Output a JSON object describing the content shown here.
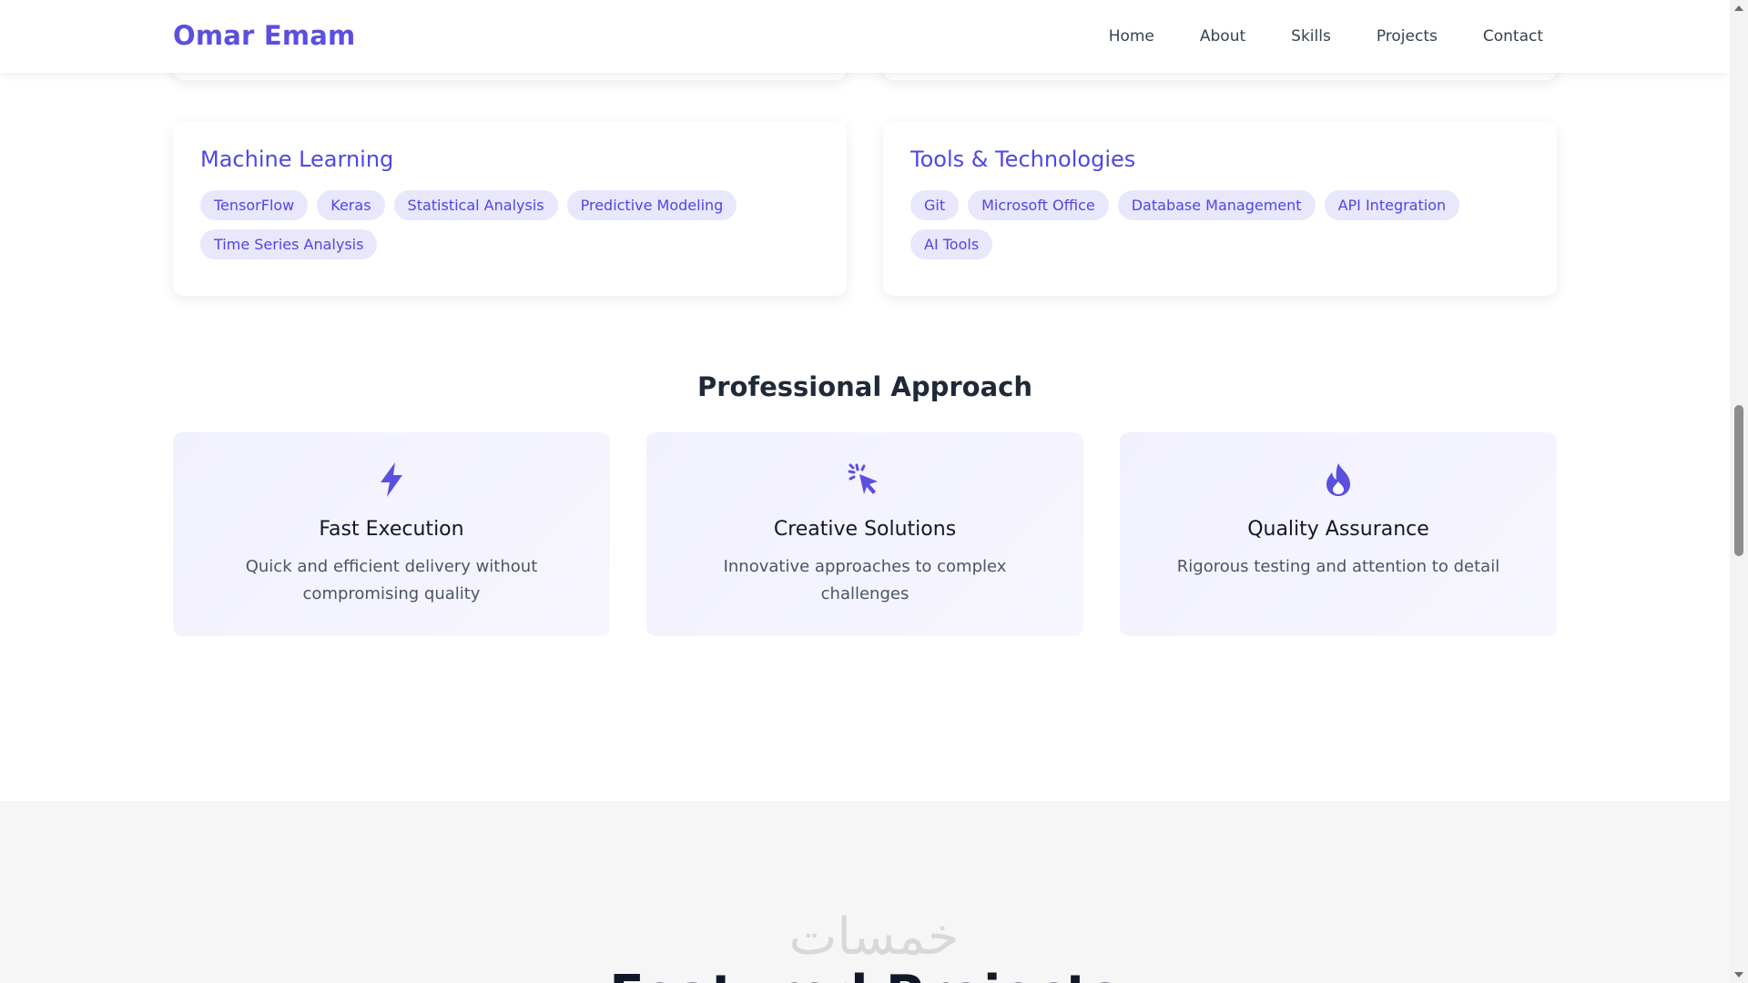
{
  "header": {
    "brand": "Omar Emam",
    "nav": [
      "Home",
      "About",
      "Skills",
      "Projects",
      "Contact"
    ]
  },
  "skills": {
    "machine_learning": {
      "title": "Machine Learning",
      "tags": [
        "TensorFlow",
        "Keras",
        "Statistical Analysis",
        "Predictive Modeling",
        "Time Series Analysis"
      ]
    },
    "tools": {
      "title": "Tools & Technologies",
      "tags": [
        "Git",
        "Microsoft Office",
        "Database Management",
        "API Integration",
        "AI Tools"
      ]
    }
  },
  "approach": {
    "title": "Professional Approach",
    "cards": [
      {
        "icon": "bolt-icon",
        "title": "Fast Execution",
        "text": "Quick and efficient delivery without compromising quality"
      },
      {
        "icon": "pointer-click-icon",
        "title": "Creative Solutions",
        "text": "Innovative approaches to complex challenges"
      },
      {
        "icon": "fire-icon",
        "title": "Quality Assurance",
        "text": "Rigorous testing and attention to detail"
      }
    ]
  },
  "next_section": {
    "heading": "Featured Projects"
  },
  "watermark": "خمسات",
  "colors": {
    "accent": "#4f46e5",
    "brand": "#5b4fe0",
    "tag_bg": "#e8e7fb"
  }
}
